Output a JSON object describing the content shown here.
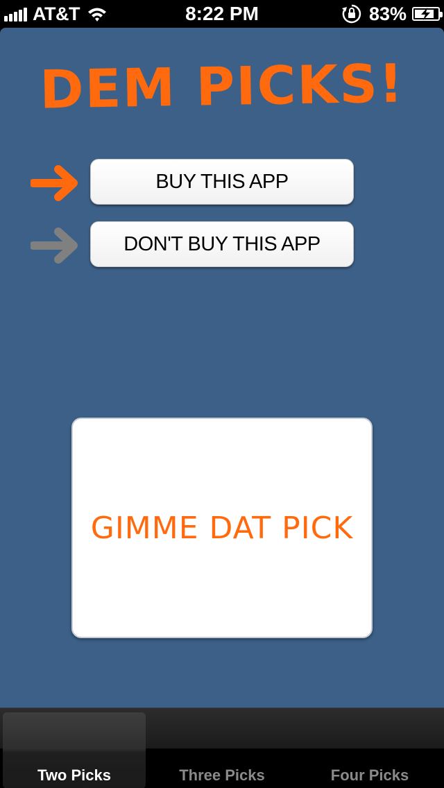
{
  "status_bar": {
    "carrier": "AT&T",
    "time": "8:22 PM",
    "battery_percent": "83%",
    "battery_level": 0.83,
    "icons": [
      "signal-icon",
      "wifi-icon",
      "rotation-lock-icon",
      "battery-charging-icon"
    ]
  },
  "app": {
    "title": "DEM PICKS!",
    "accent_color": "#ff6a0e",
    "background_color": "#3d6088"
  },
  "options": {
    "buy_label": "BUY THIS APP",
    "dont_buy_label": "DON'T BUY THIS APP",
    "selected": "buy",
    "arrow_active_color": "#ff6a0e",
    "arrow_inactive_color": "#808080"
  },
  "pick_button": {
    "label": "GIMME DAT PICK"
  },
  "tab_bar": {
    "tabs": [
      {
        "label": "Two Picks",
        "active": true
      },
      {
        "label": "Three Picks",
        "active": false
      },
      {
        "label": "Four Picks",
        "active": false
      }
    ]
  }
}
